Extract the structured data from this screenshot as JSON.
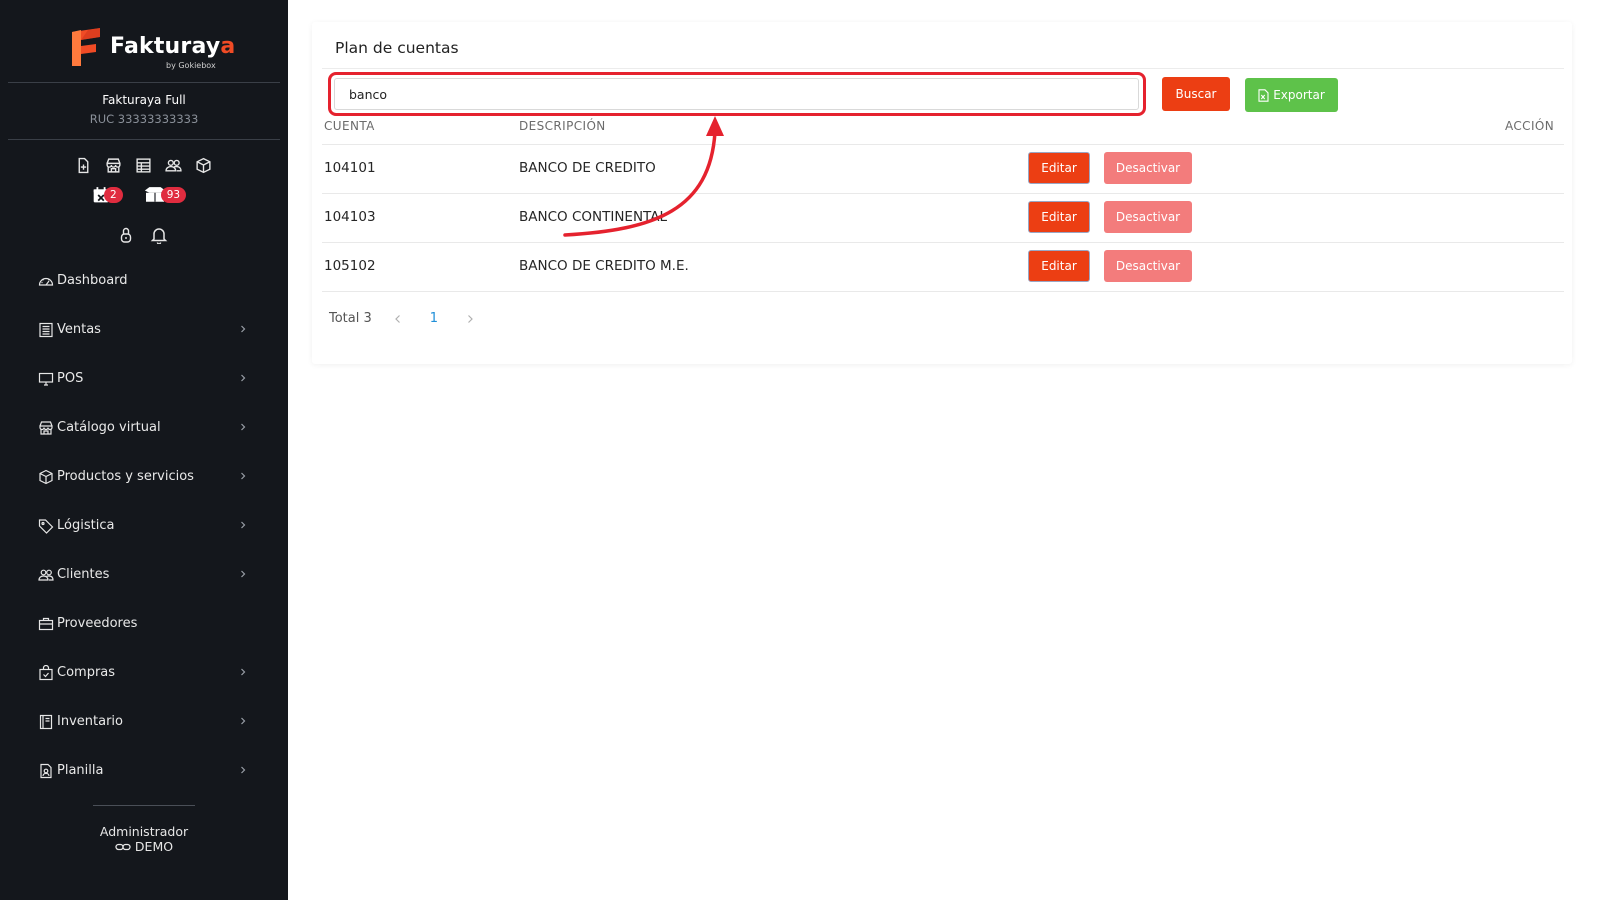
{
  "brand": {
    "name_main": "Fakturay",
    "name_accent": "a",
    "tagline": "by Gokiebox",
    "accent_color": "#f04b25"
  },
  "company": {
    "name": "Fakturaya Full",
    "ruc": "RUC 33333333333"
  },
  "quick_icons": [
    "file-plus-icon",
    "store-icon",
    "table-icon",
    "users-icon",
    "box-icon"
  ],
  "badges": {
    "calendar_count": "2",
    "packages_count": "93"
  },
  "sidebar": {
    "items": [
      {
        "label": "Dashboard",
        "icon": "gauge-icon",
        "has_children": false
      },
      {
        "label": "Ventas",
        "icon": "receipt-icon",
        "has_children": true
      },
      {
        "label": "POS",
        "icon": "monitor-icon",
        "has_children": true
      },
      {
        "label": "Catálogo virtual",
        "icon": "store-icon",
        "has_children": true
      },
      {
        "label": "Productos y servicios",
        "icon": "box-icon",
        "has_children": true
      },
      {
        "label": "Lógistica",
        "icon": "tag-icon",
        "has_children": true
      },
      {
        "label": "Clientes",
        "icon": "users-icon",
        "has_children": true
      },
      {
        "label": "Proveedores",
        "icon": "briefcase-icon",
        "has_children": false
      },
      {
        "label": "Compras",
        "icon": "bag-icon",
        "has_children": true
      },
      {
        "label": "Inventario",
        "icon": "book-icon",
        "has_children": true
      },
      {
        "label": "Planilla",
        "icon": "id-file-icon",
        "has_children": true
      }
    ]
  },
  "user": {
    "role": "Administrador",
    "name": "DEMO"
  },
  "main": {
    "title": "Plan de cuentas",
    "search": {
      "value": "banco",
      "placeholder": ""
    },
    "buttons": {
      "search": "Buscar",
      "export": "Exportar"
    },
    "table": {
      "headers": {
        "account": "CUENTA",
        "description": "DESCRIPCIÓN",
        "action": "ACCIÓN"
      },
      "rows": [
        {
          "account": "104101",
          "description": "BANCO DE CREDITO",
          "edit": "Editar",
          "deactivate": "Desactivar"
        },
        {
          "account": "104103",
          "description": "BANCO CONTINENTAL",
          "edit": "Editar",
          "deactivate": "Desactivar"
        },
        {
          "account": "105102",
          "description": "BANCO DE CREDITO M.E.",
          "edit": "Editar",
          "deactivate": "Desactivar"
        }
      ]
    },
    "pagination": {
      "total": "Total 3",
      "current_page": "1"
    }
  },
  "colors": {
    "sidebar_bg": "#14171c",
    "primary": "#ec3e13",
    "success": "#5ec24a",
    "danger_light": "#f37c7c",
    "annotation": "#e5222e"
  }
}
